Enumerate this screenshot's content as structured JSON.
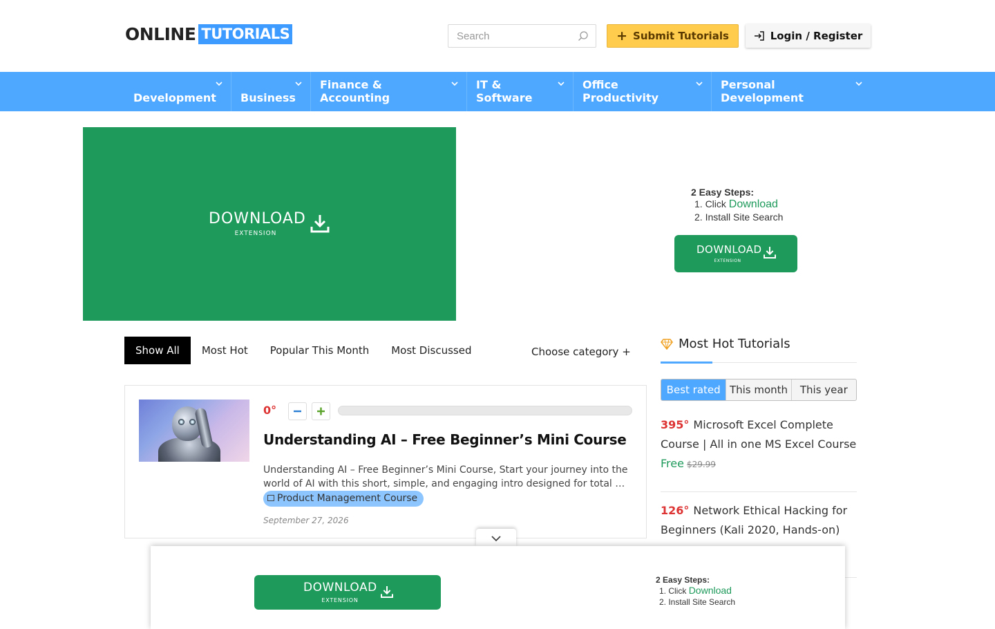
{
  "header": {
    "logo_part1": "ONLINE",
    "logo_part2": "TUTORIALS",
    "search_placeholder": "Search",
    "submit_label": "Submit Tutorials",
    "login_label": "Login / Register"
  },
  "nav": {
    "items": [
      {
        "label": "Development"
      },
      {
        "label": "Business"
      },
      {
        "label": "Finance & Accounting"
      },
      {
        "label": "IT & Software"
      },
      {
        "label": "Office Productivity"
      },
      {
        "label": "Personal Development"
      }
    ]
  },
  "banner": {
    "download_label": "DOWNLOAD",
    "extension_label": "EXTENSION"
  },
  "steps": {
    "heading": "2 Easy Steps:",
    "step1_prefix": "1. Click ",
    "step1_link": "Download",
    "step2": "2. Install Site Search",
    "button_label": "DOWNLOAD",
    "button_sub": "EXTENSION"
  },
  "filters": {
    "tabs": [
      "Show All",
      "Most Hot",
      "Popular This Month",
      "Most Discussed"
    ],
    "active_tab": "Show All",
    "choose_category": "Choose category +"
  },
  "post": {
    "score": "0°",
    "hot_level": 0,
    "title": "Understanding AI – Free Beginner’s Mini Course",
    "excerpt": "Understanding AI – Free Beginner’s Mini Course, Start your journey into the world of AI with this short, simple, and engaging intro designed for total …",
    "category": "Product Management Course",
    "date": "September 27, 2026"
  },
  "sidebar": {
    "title": "Most Hot Tutorials",
    "tabs": [
      "Best rated",
      "This month",
      "This year"
    ],
    "active_tab": "Best rated",
    "items": [
      {
        "score": "395°",
        "title": "Microsoft Excel Complete Course | All in one MS Excel Course",
        "price": "Free",
        "old_price": "$29.99"
      },
      {
        "score": "126°",
        "title": "Network Ethical Hacking for Beginners (Kali 2020, Hands-on)"
      }
    ]
  },
  "sticky": {
    "download_label": "DOWNLOAD",
    "extension_label": "EXTENSION",
    "heading": "2 Easy Steps:",
    "step1_prefix": "1. Click ",
    "step1_link": "Download",
    "step2": "2. Install Site Search"
  },
  "colors": {
    "brand_blue": "#4ea8ff",
    "download_green": "#1e9a5b",
    "submit_yellow": "#ffcc4d",
    "score_red": "#dd3333"
  }
}
